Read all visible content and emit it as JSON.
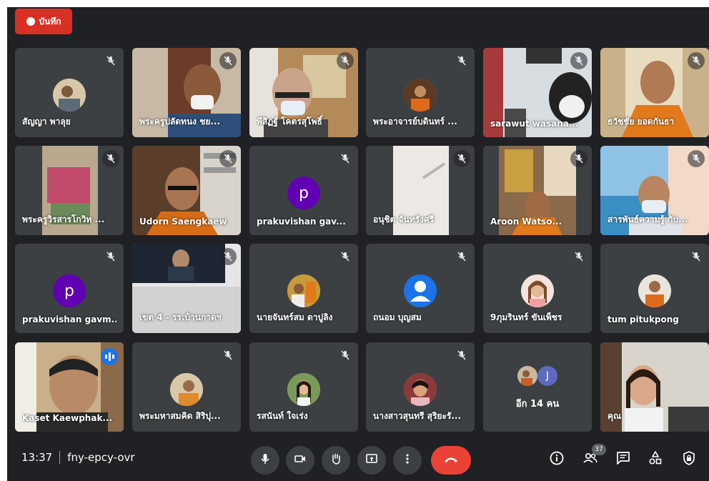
{
  "record": {
    "label": "บันทึก"
  },
  "tiles": [
    {
      "name": "สัญญา พาลุย"
    },
    {
      "name": "พระครูปลัดทนง ชย..."
    },
    {
      "name": "พีสิฏฐ์ โคตรสุโพธิ์"
    },
    {
      "name": "พระอาจารย์บดินทร์ ..."
    },
    {
      "name": "sarawut wasana..."
    },
    {
      "name": "ธวัชชัย ยอดกันธา"
    },
    {
      "name": "พระครูวิรสารโกวิท ..."
    },
    {
      "name": "Udorn Saengkaew"
    },
    {
      "name": "prakuvishan gav...",
      "initial": "p"
    },
    {
      "name": "อนุชิต จันทรังศรี"
    },
    {
      "name": "Aroon Watso..."
    },
    {
      "name": "สารพันธ์ความรู้ กับ..."
    },
    {
      "name": "prakuvishan gavm...",
      "initial": "p"
    },
    {
      "name": "เขต 4 - รร.บ้านกาดฯ"
    },
    {
      "name": "นายจันทร์สม ดาปูลิง"
    },
    {
      "name": "ถนอม บุญสม"
    },
    {
      "name": "9ภุมรินทร์ ขันเพ็ชร"
    },
    {
      "name": "tum pitukpong"
    },
    {
      "name": "Kaset Kaewphak..."
    },
    {
      "name": "พระมหาสมคิด สิริปุ..."
    },
    {
      "name": "รสนันท์ ใจเร่ง"
    },
    {
      "name": "นางสาวสุนทรี สุริยะรั..."
    },
    {
      "name": "อีก 14 คน",
      "avatar_initial": "J"
    },
    {
      "name": "คุณ"
    }
  ],
  "bottom": {
    "time": "13:37",
    "meeting_code": "fny-epcy-ovr",
    "people_count": "37"
  },
  "colors": {
    "background": "#202124",
    "tile": "#3c4043",
    "end_call": "#ea4335",
    "record": "#d93025",
    "active_outline": "#8ab4f8"
  }
}
